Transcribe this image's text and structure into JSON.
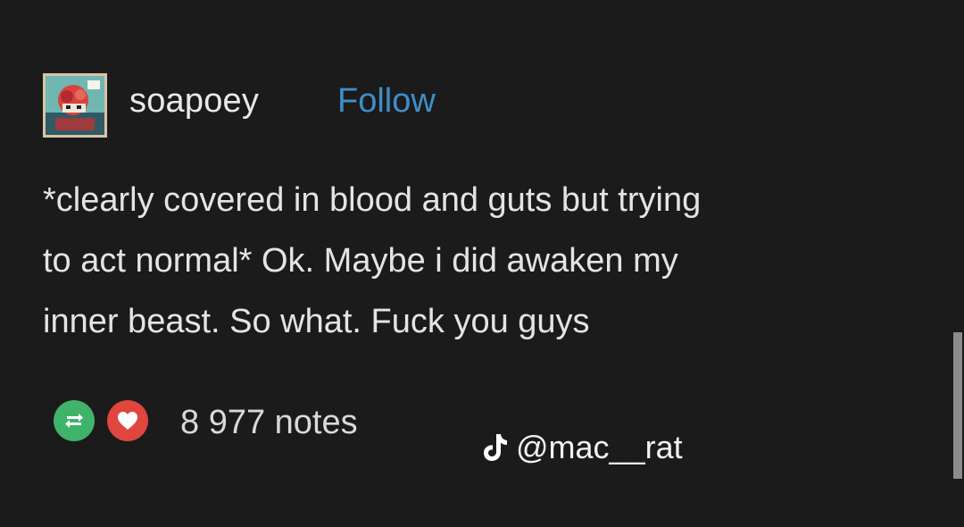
{
  "post": {
    "username": "soapoey",
    "follow_label": "Follow",
    "lines": [
      "*clearly covered in blood and guts but trying",
      "to act normal* Ok. Maybe i did awaken my",
      "inner beast. So what. Fuck you guys"
    ],
    "notes_count": "8 977 notes"
  },
  "watermark": {
    "handle": "@mac__rat",
    "icon": "tiktok-icon"
  },
  "colors": {
    "background": "#1b1b1b",
    "text": "#e4e4e4",
    "follow": "#3f8fc8",
    "reblog": "#3fb36a",
    "like": "#e0463d"
  },
  "icons": {
    "reblog": "reblog-icon",
    "like": "heart-icon"
  }
}
